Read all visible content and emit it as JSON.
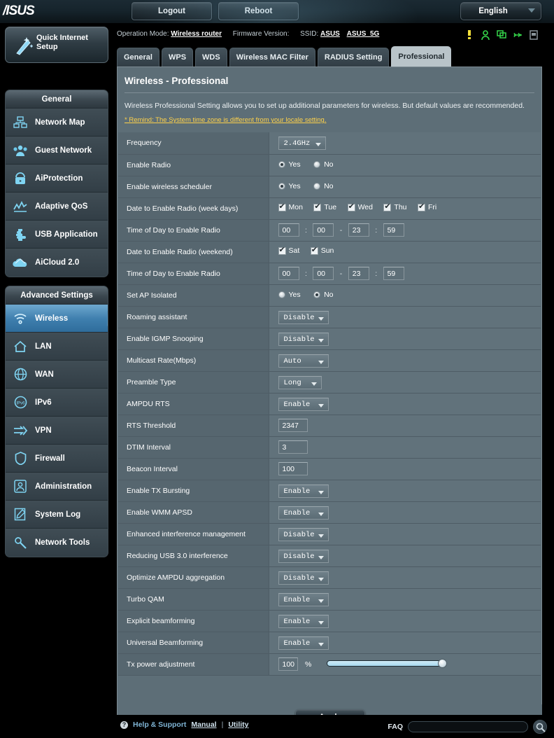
{
  "header": {
    "logo": "/ISUS",
    "logout_label": "Logout",
    "reboot_label": "Reboot",
    "language": "English"
  },
  "infostrip": {
    "operation_mode_label": "Operation Mode:",
    "operation_mode_value": "Wireless router",
    "firmware_label": "Firmware Version:",
    "firmware_value": "",
    "ssid_label": "SSID:",
    "ssid_24": "ASUS",
    "ssid_5g": "ASUS_5G",
    "icons": [
      "warning-light-icon",
      "guest-user-icon",
      "clients-monitor-icon",
      "usb-icon",
      "printer-icon"
    ]
  },
  "sidebar": {
    "quick_setup_label": "Quick Internet Setup",
    "groups": [
      {
        "title": "General",
        "items": [
          {
            "label": "Network Map",
            "icon": "network-map-icon",
            "active": false
          },
          {
            "label": "Guest Network",
            "icon": "guest-network-icon",
            "active": false
          },
          {
            "label": "AiProtection",
            "icon": "shield-lock-icon",
            "active": false
          },
          {
            "label": "Adaptive QoS",
            "icon": "qos-chart-icon",
            "active": false
          },
          {
            "label": "USB Application",
            "icon": "usb-puzzle-icon",
            "active": false
          },
          {
            "label": "AiCloud 2.0",
            "icon": "cloud-icon",
            "active": false
          }
        ]
      },
      {
        "title": "Advanced Settings",
        "items": [
          {
            "label": "Wireless",
            "icon": "wifi-icon",
            "active": true
          },
          {
            "label": "LAN",
            "icon": "home-icon",
            "active": false
          },
          {
            "label": "WAN",
            "icon": "globe-icon",
            "active": false
          },
          {
            "label": "IPv6",
            "icon": "ipv6-globe-icon",
            "active": false
          },
          {
            "label": "VPN",
            "icon": "vpn-arrows-icon",
            "active": false
          },
          {
            "label": "Firewall",
            "icon": "firewall-shield-icon",
            "active": false
          },
          {
            "label": "Administration",
            "icon": "admin-user-icon",
            "active": false
          },
          {
            "label": "System Log",
            "icon": "system-log-icon",
            "active": false
          },
          {
            "label": "Network Tools",
            "icon": "network-tools-icon",
            "active": false
          }
        ]
      }
    ]
  },
  "tabs": [
    {
      "label": "General",
      "active": false
    },
    {
      "label": "WPS",
      "active": false
    },
    {
      "label": "WDS",
      "active": false
    },
    {
      "label": "Wireless MAC Filter",
      "active": false
    },
    {
      "label": "RADIUS Setting",
      "active": false
    },
    {
      "label": "Professional",
      "active": true
    }
  ],
  "panel": {
    "title": "Wireless - Professional",
    "description": "Wireless Professional Setting allows you to set up additional parameters for wireless. But default values are recommended.",
    "remind": "* Remind: The System time zone is different from your locale setting.",
    "apply_label": "Apply"
  },
  "form": {
    "frequency": {
      "label": "Frequency",
      "value": "2.4GHz"
    },
    "enable_radio": {
      "label": "Enable Radio",
      "yes": "Yes",
      "no": "No",
      "selected": "yes"
    },
    "enable_scheduler": {
      "label": "Enable wireless scheduler",
      "yes": "Yes",
      "no": "No",
      "selected": "yes"
    },
    "week_days": {
      "label": "Date to Enable Radio (week days)",
      "days": [
        {
          "label": "Mon",
          "checked": true
        },
        {
          "label": "Tue",
          "checked": true
        },
        {
          "label": "Wed",
          "checked": true
        },
        {
          "label": "Thu",
          "checked": true
        },
        {
          "label": "Fri",
          "checked": true
        }
      ]
    },
    "week_time": {
      "label": "Time of Day to Enable Radio",
      "start_hour": "00",
      "start_min": "00",
      "end_hour": "23",
      "end_min": "59",
      "sep_colon": ":",
      "sep_dash": "-"
    },
    "weekend_days": {
      "label": "Date to Enable Radio (weekend)",
      "days": [
        {
          "label": "Sat",
          "checked": true
        },
        {
          "label": "Sun",
          "checked": true
        }
      ]
    },
    "weekend_time": {
      "label": "Time of Day to Enable Radio",
      "start_hour": "00",
      "start_min": "00",
      "end_hour": "23",
      "end_min": "59"
    },
    "ap_isolated": {
      "label": "Set AP Isolated",
      "yes": "Yes",
      "no": "No",
      "selected": "no"
    },
    "roaming_assistant": {
      "label": "Roaming assistant",
      "value": "Disable"
    },
    "igmp_snooping": {
      "label": "Enable IGMP Snooping",
      "value": "Disable"
    },
    "multicast_rate": {
      "label": "Multicast Rate(Mbps)",
      "value": "Auto"
    },
    "preamble_type": {
      "label": "Preamble Type",
      "value": "Long"
    },
    "ampdu_rts": {
      "label": "AMPDU RTS",
      "value": "Enable"
    },
    "rts_threshold": {
      "label": "RTS Threshold",
      "value": "2347"
    },
    "dtim_interval": {
      "label": "DTIM Interval",
      "value": "3"
    },
    "beacon_interval": {
      "label": "Beacon Interval",
      "value": "100"
    },
    "tx_bursting": {
      "label": "Enable TX Bursting",
      "value": "Enable"
    },
    "wmm_apsd": {
      "label": "Enable WMM APSD",
      "value": "Enable"
    },
    "enhanced_interference": {
      "label": "Enhanced interference management",
      "value": "Disable"
    },
    "usb3_interference": {
      "label": "Reducing USB 3.0 interference",
      "value": "Disable"
    },
    "optimize_ampdu": {
      "label": "Optimize AMPDU aggregation",
      "value": "Disable"
    },
    "turbo_qam": {
      "label": "Turbo QAM",
      "value": "Enable"
    },
    "explicit_beamforming": {
      "label": "Explicit beamforming",
      "value": "Enable"
    },
    "universal_beamforming": {
      "label": "Universal Beamforming",
      "value": "Enable"
    },
    "tx_power": {
      "label": "Tx power adjustment",
      "value": "100",
      "unit": "%",
      "slider_percent": 100
    }
  },
  "footer": {
    "help_label": "Help & Support",
    "manual_label": "Manual",
    "separator": "|",
    "utility_label": "Utility",
    "faq_label": "FAQ",
    "faq_value": ""
  },
  "colors": {
    "accent_blue": "#4d8cb8",
    "panel_bg": "#5d6e77",
    "label_bg": "#56666f",
    "value_bg": "#61727b",
    "warning_yellow": "#ffd24a",
    "link_blue": "#7fb4d4"
  }
}
